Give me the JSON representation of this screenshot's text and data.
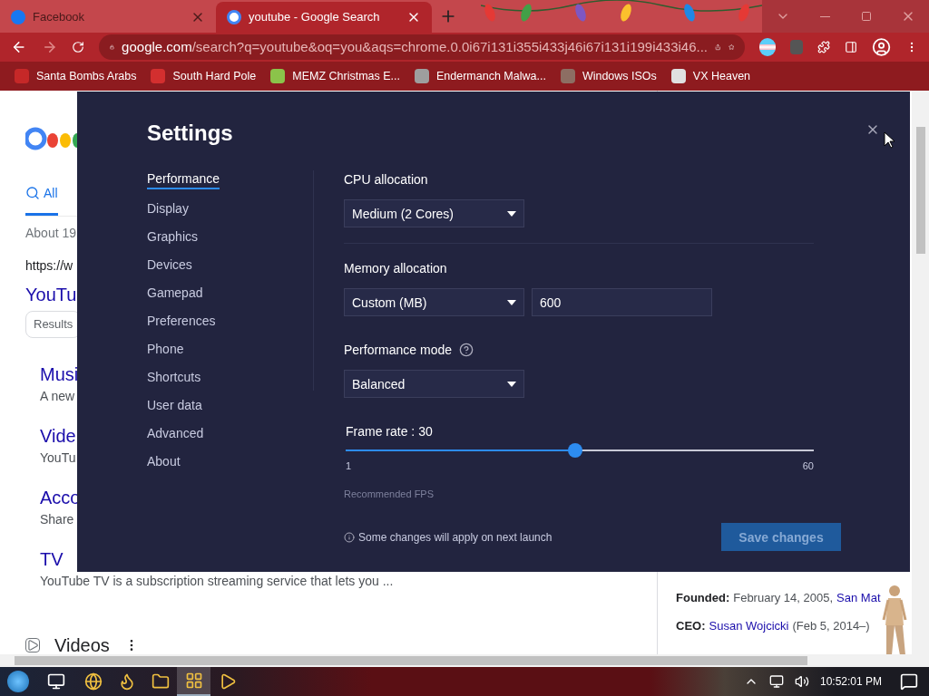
{
  "browser": {
    "tabs": [
      {
        "title": "Facebook",
        "selected": false
      },
      {
        "title": "youtube - Google Search",
        "selected": true
      }
    ],
    "address": {
      "host": "google.com",
      "path": "/search?q=youtube&oq=you&aqs=chrome.0.0i67i131i355i433j46i67i131i199i433i46..."
    },
    "bookmarks": [
      "Santa Bombs Arabs",
      "South Hard Pole",
      "MEMZ Christmas E...",
      "Endermanch Malwa...",
      "Windows ISOs",
      "VX Heaven"
    ]
  },
  "search_page": {
    "tab": {
      "label": "All",
      "selected": true
    },
    "result_count": "About 19",
    "url": "https://w",
    "title": "YouTu",
    "chip": "Results",
    "sitelinks": [
      {
        "title": "Musi",
        "snippet": "A new"
      },
      {
        "title": "Vide",
        "snippet": "YouTu"
      },
      {
        "title": "Acco",
        "snippet": "Share"
      },
      {
        "title": "TV",
        "snippet": "YouTube TV is a subscription streaming service that lets you ..."
      }
    ],
    "videos_heading": "Videos",
    "facts": [
      {
        "parts": [
          {
            "kind": "label",
            "text": "Founded:"
          },
          {
            "kind": "text",
            "text": "February 14, 2005,"
          },
          {
            "kind": "link",
            "text": "San Mat"
          }
        ]
      },
      {
        "parts": [
          {
            "kind": "label",
            "text": "CEO:"
          },
          {
            "kind": "link",
            "text": "Susan Wojcicki"
          },
          {
            "kind": "text",
            "text": "(Feb 5, 2014–)"
          }
        ]
      }
    ]
  },
  "settings": {
    "title": "Settings",
    "nav": [
      {
        "label": "Performance",
        "selected": true
      },
      {
        "label": "Display",
        "selected": false
      },
      {
        "label": "Graphics",
        "selected": false
      },
      {
        "label": "Devices",
        "selected": false
      },
      {
        "label": "Gamepad",
        "selected": false
      },
      {
        "label": "Preferences",
        "selected": false
      },
      {
        "label": "Phone",
        "selected": false
      },
      {
        "label": "Shortcuts",
        "selected": false
      },
      {
        "label": "User data",
        "selected": false
      },
      {
        "label": "Advanced",
        "selected": false
      },
      {
        "label": "About",
        "selected": false
      }
    ],
    "fields": [
      {
        "kind": "select",
        "label": "CPU allocation",
        "value": "Medium (2 Cores)",
        "help": false,
        "separated": true
      },
      {
        "kind": "select_input",
        "label": "Memory allocation",
        "value": "Custom (MB)",
        "input": "600",
        "help": false,
        "separated": false
      },
      {
        "kind": "select",
        "label": "Performance mode",
        "value": "Balanced",
        "help": true,
        "separated": false
      }
    ],
    "frame_rate": {
      "label": "Frame rate : 30",
      "level": 0.49,
      "min": "1",
      "max": "60",
      "hint": "Recommended FPS"
    },
    "note": "Some changes will apply on next launch",
    "save": "Save changes"
  },
  "taskbar": {
    "apps": [
      {
        "kind": "chrome",
        "active": false
      },
      {
        "kind": "firefox",
        "active": false
      },
      {
        "kind": "explorer",
        "active": false
      },
      {
        "kind": "stack",
        "active": true
      },
      {
        "kind": "app",
        "active": false
      }
    ],
    "clock": "10:52:01 PM"
  }
}
